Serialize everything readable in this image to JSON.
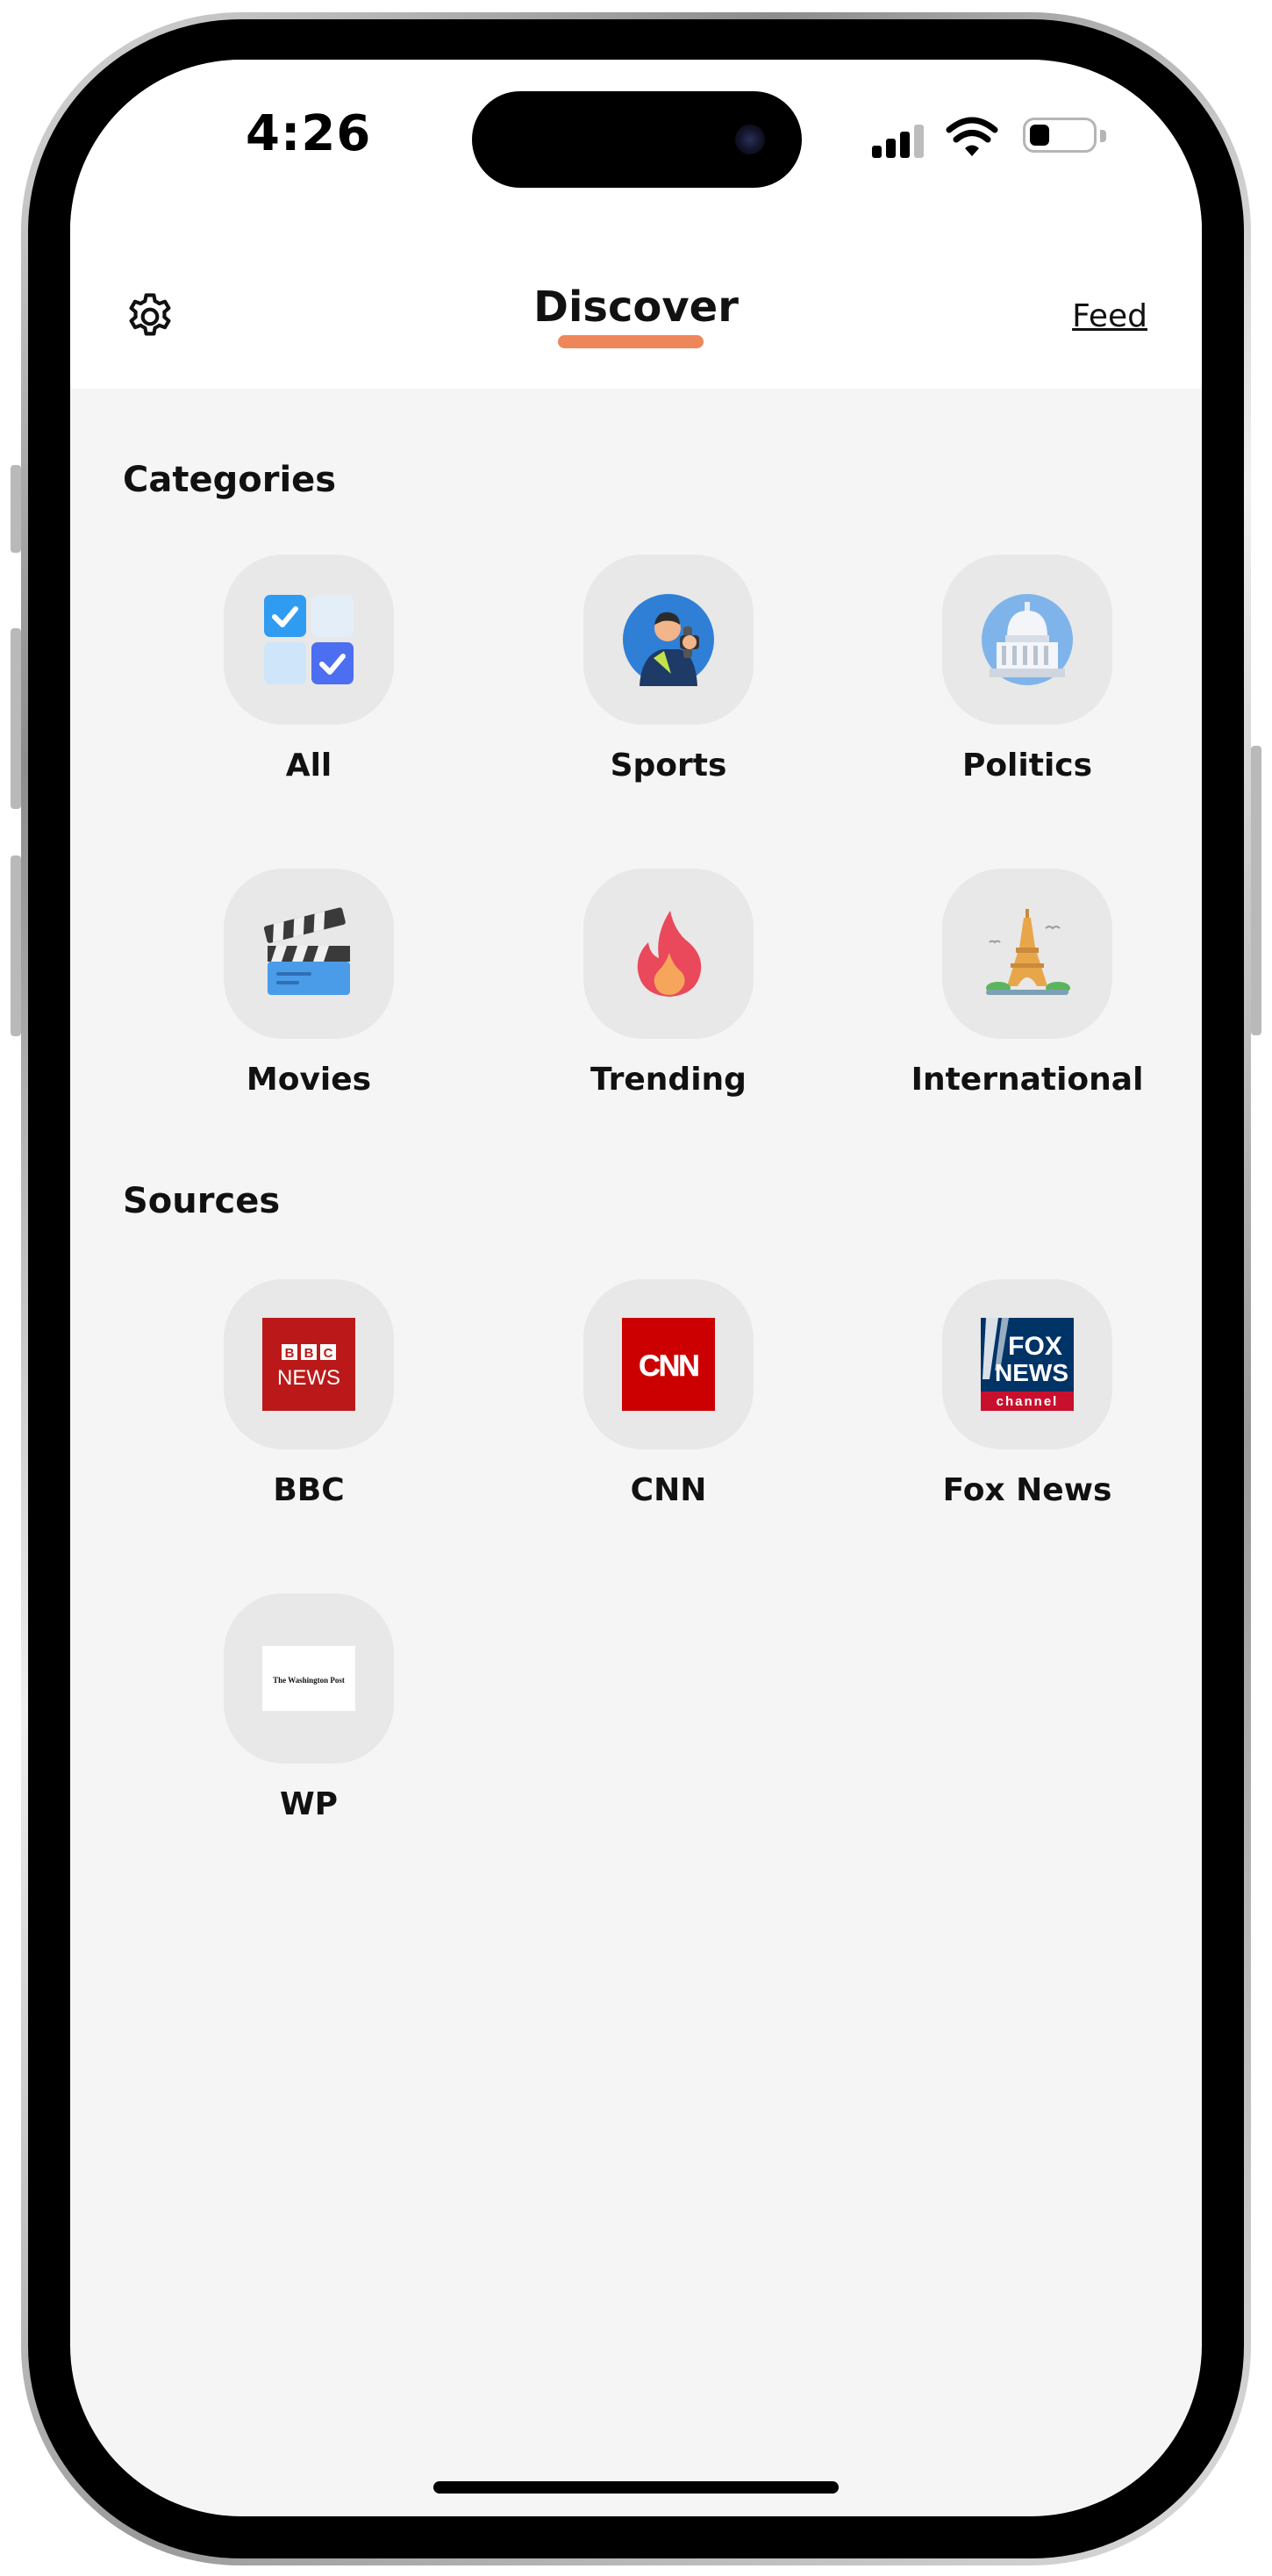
{
  "status_bar": {
    "time": "4:26",
    "battery_level": 0.3,
    "icons": [
      "signal-icon",
      "wifi-icon",
      "battery-icon"
    ]
  },
  "header": {
    "title": "Discover",
    "feed_link": "Feed",
    "settings_icon": "gear-icon",
    "accent_color": "#ef8659"
  },
  "categories": {
    "title": "Categories",
    "items": [
      {
        "label": "All",
        "icon": "checkbox-grid-icon"
      },
      {
        "label": "Sports",
        "icon": "athlete-icon"
      },
      {
        "label": "Politics",
        "icon": "capitol-icon"
      },
      {
        "label": "Movies",
        "icon": "clapperboard-icon"
      },
      {
        "label": "Trending",
        "icon": "flame-icon"
      },
      {
        "label": "International",
        "icon": "eiffel-tower-icon"
      }
    ]
  },
  "sources": {
    "title": "Sources",
    "items": [
      {
        "label": "BBC",
        "icon": "bbc-news-logo",
        "logo_text_1": "BBC",
        "logo_text_2": "NEWS"
      },
      {
        "label": "CNN",
        "icon": "cnn-logo",
        "logo_text_1": "CNN"
      },
      {
        "label": "Fox News",
        "icon": "fox-news-logo",
        "logo_text_1": "FOX",
        "logo_text_2": "NEWS",
        "logo_text_3": "channel"
      },
      {
        "label": "WP",
        "icon": "washington-post-logo",
        "logo_text_1": "The Washington Post"
      }
    ]
  }
}
